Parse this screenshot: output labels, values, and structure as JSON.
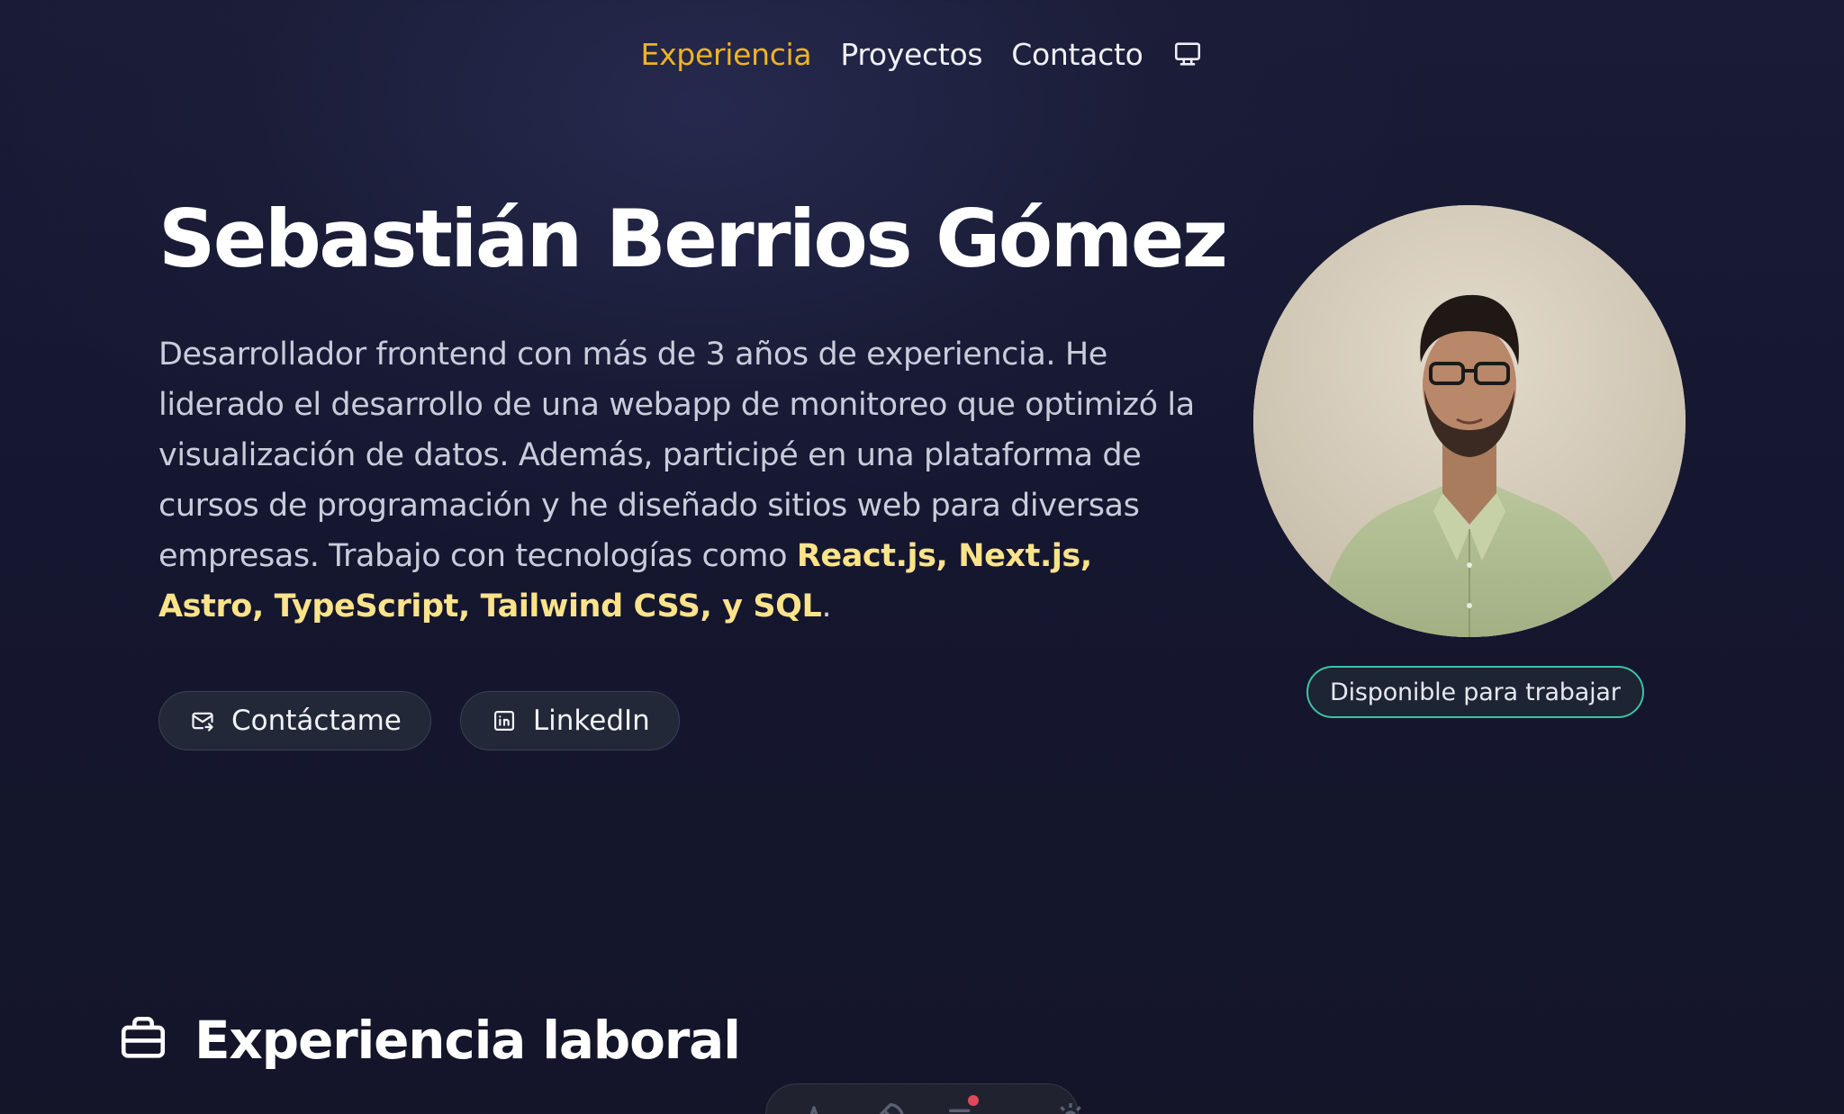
{
  "nav": {
    "items": [
      {
        "label": "Experiencia",
        "active": true
      },
      {
        "label": "Proyectos",
        "active": false
      },
      {
        "label": "Contacto",
        "active": false
      }
    ],
    "theme_icon": "monitor-icon"
  },
  "hero": {
    "name": "Sebastián Berrios Gómez",
    "description": "Desarrollador frontend con más de 3 años de experiencia. He liderado el desarrollo de una webapp de monitoreo que optimizó la visualización de datos. Además, participé en una plataforma de cursos de programación y he diseñado sitios web para diversas empresas. Trabajo con tecnologías como ",
    "technologies": "React.js, Next.js, Astro, TypeScript, Tailwind CSS, y SQL",
    "description_end": ".",
    "buttons": {
      "contact": {
        "label": "Contáctame",
        "icon": "mail-forward-icon"
      },
      "linkedin": {
        "label": "LinkedIn",
        "icon": "linkedin-icon"
      }
    },
    "badge": "Disponible para trabajar"
  },
  "section": {
    "title": "Experiencia laboral",
    "icon": "briefcase-icon"
  },
  "dock": {
    "icons": [
      "translate-icon",
      "rocket-icon",
      "notifications-icon",
      "settings-icon"
    ]
  },
  "colors": {
    "accent": "#f0b324",
    "tech_highlight": "#fbe38a",
    "badge_border": "#3dc4a3",
    "background": "#161830"
  }
}
